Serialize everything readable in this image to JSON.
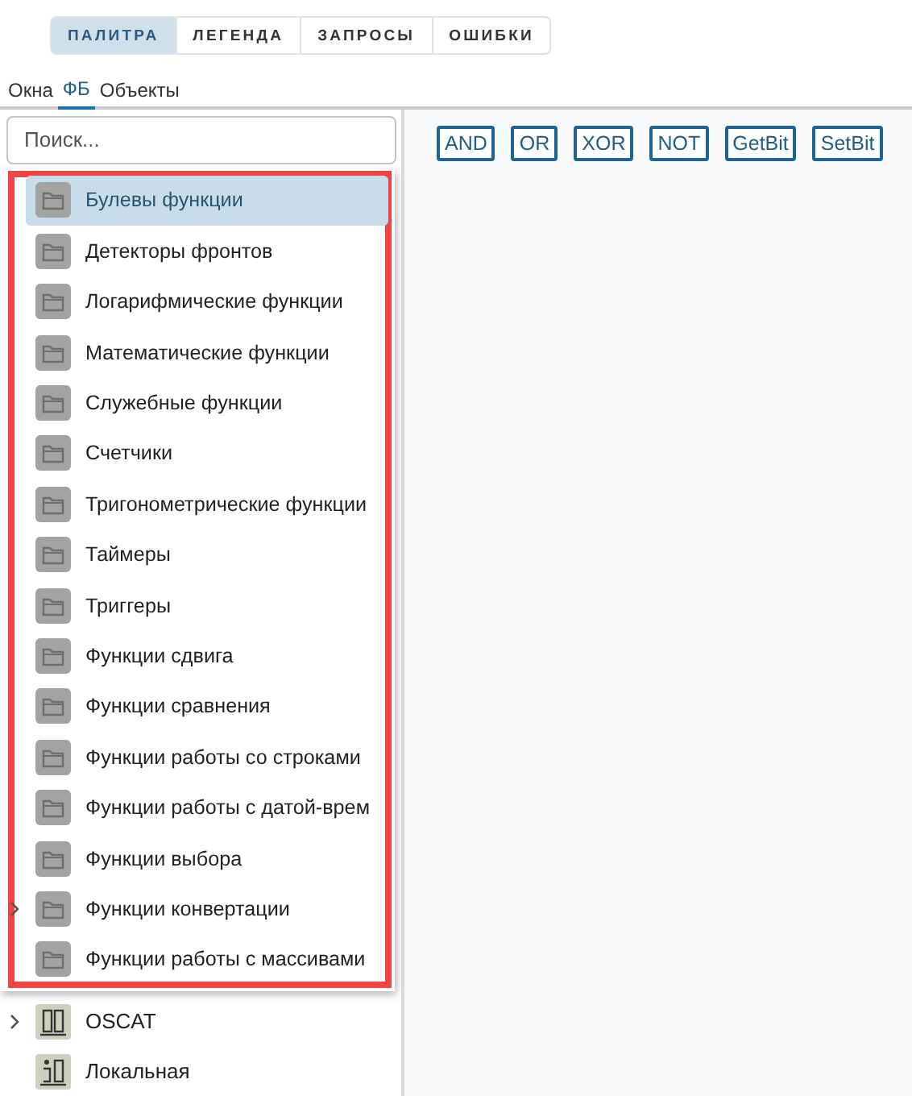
{
  "tabs": [
    {
      "label": "ПАЛИТРА",
      "selected": true
    },
    {
      "label": "ЛЕГЕНДА",
      "selected": false
    },
    {
      "label": "ЗАПРОСЫ",
      "selected": false
    },
    {
      "label": "ОШИБКИ",
      "selected": false
    }
  ],
  "subtabs": [
    {
      "label": "Окна",
      "selected": false
    },
    {
      "label": "ФБ",
      "selected": true
    },
    {
      "label": "Объекты",
      "selected": false
    }
  ],
  "search": {
    "placeholder": "Поиск..."
  },
  "popup": {
    "highlighted": true,
    "items": [
      {
        "label": "Булевы функции",
        "selected": true
      },
      {
        "label": "Детекторы фронтов",
        "selected": false
      },
      {
        "label": "Логарифмические функции",
        "selected": false
      },
      {
        "label": "Математические функции",
        "selected": false
      },
      {
        "label": "Служебные функции",
        "selected": false
      },
      {
        "label": "Счетчики",
        "selected": false
      },
      {
        "label": "Тригонометрические функции",
        "selected": false
      },
      {
        "label": "Таймеры",
        "selected": false
      },
      {
        "label": "Триггеры",
        "selected": false
      },
      {
        "label": "Функции сдвига",
        "selected": false
      },
      {
        "label": "Функции сравнения",
        "selected": false
      },
      {
        "label": "Функции работы со строками",
        "selected": false
      },
      {
        "label": "Функции работы с датой-врем",
        "selected": false
      },
      {
        "label": "Функции выбора",
        "selected": false
      },
      {
        "label": "Функции конвертации",
        "selected": false,
        "expandable": true
      },
      {
        "label": "Функции работы с массивами",
        "selected": false
      }
    ]
  },
  "tree": [
    {
      "label": "OSCAT",
      "kind": "library",
      "expandable": true
    },
    {
      "label": "Локальная",
      "kind": "local"
    }
  ],
  "blocks": [
    "AND",
    "OR",
    "XOR",
    "NOT",
    "GetBit",
    "SetBit"
  ]
}
